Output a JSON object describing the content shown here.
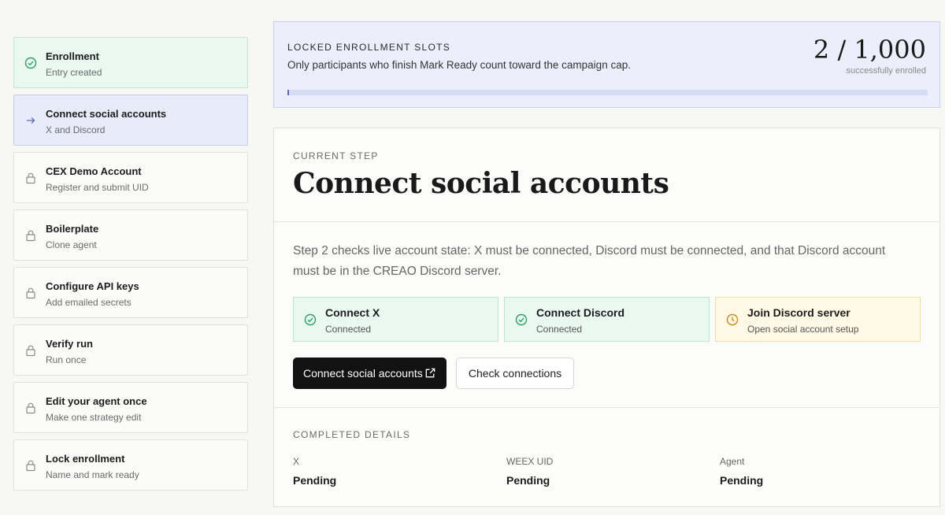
{
  "sidebar": {
    "steps": [
      {
        "title": "Enrollment",
        "subtitle": "Entry created",
        "state": "done",
        "icon": "check-circle-icon"
      },
      {
        "title": "Connect social accounts",
        "subtitle": "X and Discord",
        "state": "active",
        "icon": "arrow-right-icon"
      },
      {
        "title": "CEX Demo Account",
        "subtitle": "Register and submit UID",
        "state": "locked",
        "icon": "lock-icon"
      },
      {
        "title": "Boilerplate",
        "subtitle": "Clone agent",
        "state": "locked",
        "icon": "lock-icon"
      },
      {
        "title": "Configure API keys",
        "subtitle": "Add emailed secrets",
        "state": "locked",
        "icon": "lock-icon"
      },
      {
        "title": "Verify run",
        "subtitle": "Run once",
        "state": "locked",
        "icon": "lock-icon"
      },
      {
        "title": "Edit your agent once",
        "subtitle": "Make one strategy edit",
        "state": "locked",
        "icon": "lock-icon"
      },
      {
        "title": "Lock enrollment",
        "subtitle": "Name and mark ready",
        "state": "locked",
        "icon": "lock-icon"
      }
    ]
  },
  "slots": {
    "label": "LOCKED ENROLLMENT SLOTS",
    "description": "Only participants who finish Mark Ready count toward the campaign cap.",
    "count": "2 / 1,000",
    "count_sub": "successfully enrolled",
    "progress_fraction": 0.002
  },
  "current": {
    "label": "CURRENT STEP",
    "title": "Connect social accounts",
    "description": "Step 2 checks live account state: X must be connected, Discord must be connected, and that Discord account must be in the CREAO Discord server.",
    "checks": [
      {
        "title": "Connect X",
        "status": "Connected",
        "state": "ok",
        "icon": "check-circle-icon"
      },
      {
        "title": "Connect Discord",
        "status": "Connected",
        "state": "ok",
        "icon": "check-circle-icon"
      },
      {
        "title": "Join Discord server",
        "status": "Open social account setup",
        "state": "pending",
        "icon": "clock-icon"
      }
    ],
    "primary_button": "Connect social accounts",
    "secondary_button": "Check connections"
  },
  "completed": {
    "label": "COMPLETED DETAILS",
    "items": [
      {
        "key": "X",
        "value": "Pending"
      },
      {
        "key": "WEEX UID",
        "value": "Pending"
      },
      {
        "key": "Agent",
        "value": "Pending"
      }
    ]
  },
  "colors": {
    "done_bg": "#e9f8f0",
    "active_bg": "#e8ecfa",
    "success": "#2f9e62",
    "active_arrow": "#5a6ab8",
    "warning": "#d08a1c",
    "locked": "#8a8a8a",
    "primary": "#121212"
  }
}
